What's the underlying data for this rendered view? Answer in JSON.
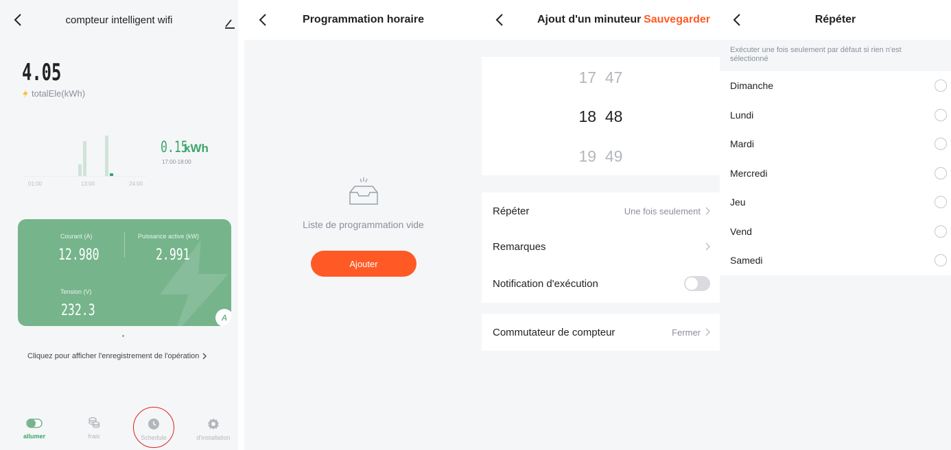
{
  "meter": {
    "title": "compteur intelligent wifi",
    "total_value": "4.05",
    "total_label": "totalEle(kWh)",
    "chart_value": "0.15",
    "chart_unit": "kWh",
    "chart_range": "17:00-18:00",
    "x_ticks": [
      "01:00",
      "13:00",
      "24:00"
    ],
    "stats": {
      "current_label": "Courant (A)",
      "current_value": "12.980",
      "power_label": "Puissance active (kW)",
      "power_value": "2.991",
      "voltage_label": "Tension (V)",
      "voltage_value": "232.3",
      "badge": "A"
    },
    "record_link": "Cliquez pour afficher l'enregistrement de l'opération",
    "tabs": [
      {
        "label": "allumer",
        "icon": "toggle-icon",
        "active": true
      },
      {
        "label": "frais",
        "icon": "coins-icon",
        "active": false
      },
      {
        "label": "Schedule",
        "icon": "clock-icon",
        "active": false
      },
      {
        "label": "d'installation",
        "icon": "gear-icon",
        "active": false
      }
    ]
  },
  "schedule": {
    "title": "Programmation horaire",
    "empty_text": "Liste de programmation vide",
    "add_label": "Ajouter"
  },
  "timer": {
    "title": "Ajout d'un minuteur",
    "save_label": "Sauvegarder",
    "picker": {
      "hours": [
        "17",
        "18",
        "19"
      ],
      "minutes": [
        "47",
        "48",
        "49"
      ]
    },
    "repeat_label": "Répéter",
    "repeat_value": "Une fois seulement",
    "remarks_label": "Remarques",
    "notify_label": "Notification d'exécution",
    "notify_on": false,
    "switch_label": "Commutateur de compteur",
    "switch_value": "Fermer"
  },
  "repeat": {
    "title": "Répéter",
    "hint": "Exécuter une fois seulement par défaut si rien n'est sélectionné",
    "days": [
      "Dimanche",
      "Lundi",
      "Mardi",
      "Mercredi",
      "Jeu",
      "Vend",
      "Samedi"
    ]
  },
  "colors": {
    "accent_green": "#76b48c",
    "accent_orange": "#ff5a25",
    "annotation_red": "#e02020"
  }
}
